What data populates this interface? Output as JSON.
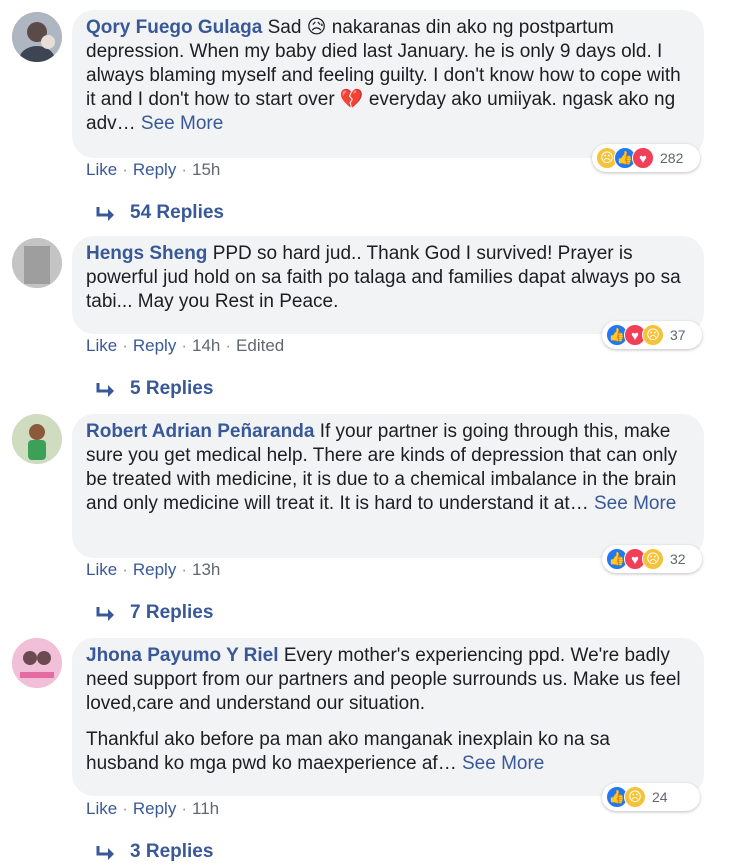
{
  "comments": [
    {
      "author": "Qory Fuego Gulaga",
      "lead": "Sad 😥",
      "text": "nakaranas din ako ng postpartum depression. When my baby died last January. he is only 9 days old. I always blaming myself and feeling guilty. I don't know how to cope with it and I don't how to start over 💔 everyday ako umiiyak. ngask ako ng adv…",
      "see_more": "See More",
      "reactions": [
        "sad",
        "like",
        "love"
      ],
      "reaction_count": "282",
      "actions": {
        "like": "Like",
        "reply": "Reply",
        "time": "15h"
      },
      "replies": "54 Replies"
    },
    {
      "author": "Hengs Sheng",
      "text": "PPD so hard jud.. Thank God I survived! Prayer is powerful jud hold on sa faith po talaga and families dapat always po sa tabi... May you Rest in Peace.",
      "reactions": [
        "like",
        "love",
        "sad"
      ],
      "reaction_count": "37",
      "actions": {
        "like": "Like",
        "reply": "Reply",
        "time": "14h",
        "edited": "Edited"
      },
      "replies": "5 Replies"
    },
    {
      "author": "Robert Adrian Peñaranda",
      "text": "If your partner is going through this, make sure you get medical help. There are kinds of depression that can only be treated with medicine, it is due to a chemical imbalance in the brain and only medicine will treat it. It is hard to understand it at…",
      "see_more": "See More",
      "reactions": [
        "like",
        "love",
        "sad"
      ],
      "reaction_count": "32",
      "actions": {
        "like": "Like",
        "reply": "Reply",
        "time": "13h"
      },
      "replies": "7 Replies"
    },
    {
      "author": "Jhona Payumo Y Riel",
      "text": "Every mother's experiencing ppd. We're badly need support from our partners and people surrounds us. Make us feel loved,care and understand our situation.",
      "text2": "Thankful ako before pa man ako manganak inexplain ko na sa husband ko mga pwd ko maexperience af…",
      "see_more": "See More",
      "reactions": [
        "like",
        "sad"
      ],
      "reaction_count": "24",
      "actions": {
        "like": "Like",
        "reply": "Reply",
        "time": "11h"
      },
      "replies": "3 Replies"
    }
  ],
  "colors": {
    "link": "#385898",
    "bubble": "#f2f3f5",
    "meta": "#606770"
  }
}
